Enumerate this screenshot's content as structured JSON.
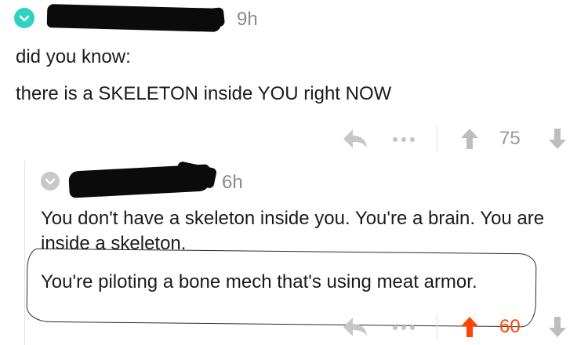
{
  "colors": {
    "op_badge": "#2dd3c0",
    "reply_badge": "#c8c8c8",
    "upvote_active": "#ff4500",
    "muted": "#9a9a9a"
  },
  "top_comment": {
    "timestamp": "9h",
    "lines": [
      "did you know:",
      "there is a SKELETON inside YOU right NOW"
    ],
    "score": "75",
    "more_icon": "ellipsis-icon",
    "reply_icon": "reply-arrow-icon"
  },
  "reply_comment": {
    "timestamp": "6h",
    "paragraph_1": "You don't have a skeleton inside you. You're a brain. You are inside a skeleton.",
    "paragraph_2": "You're piloting a bone mech that's using meat armor.",
    "score": "60",
    "upvoted": true
  }
}
